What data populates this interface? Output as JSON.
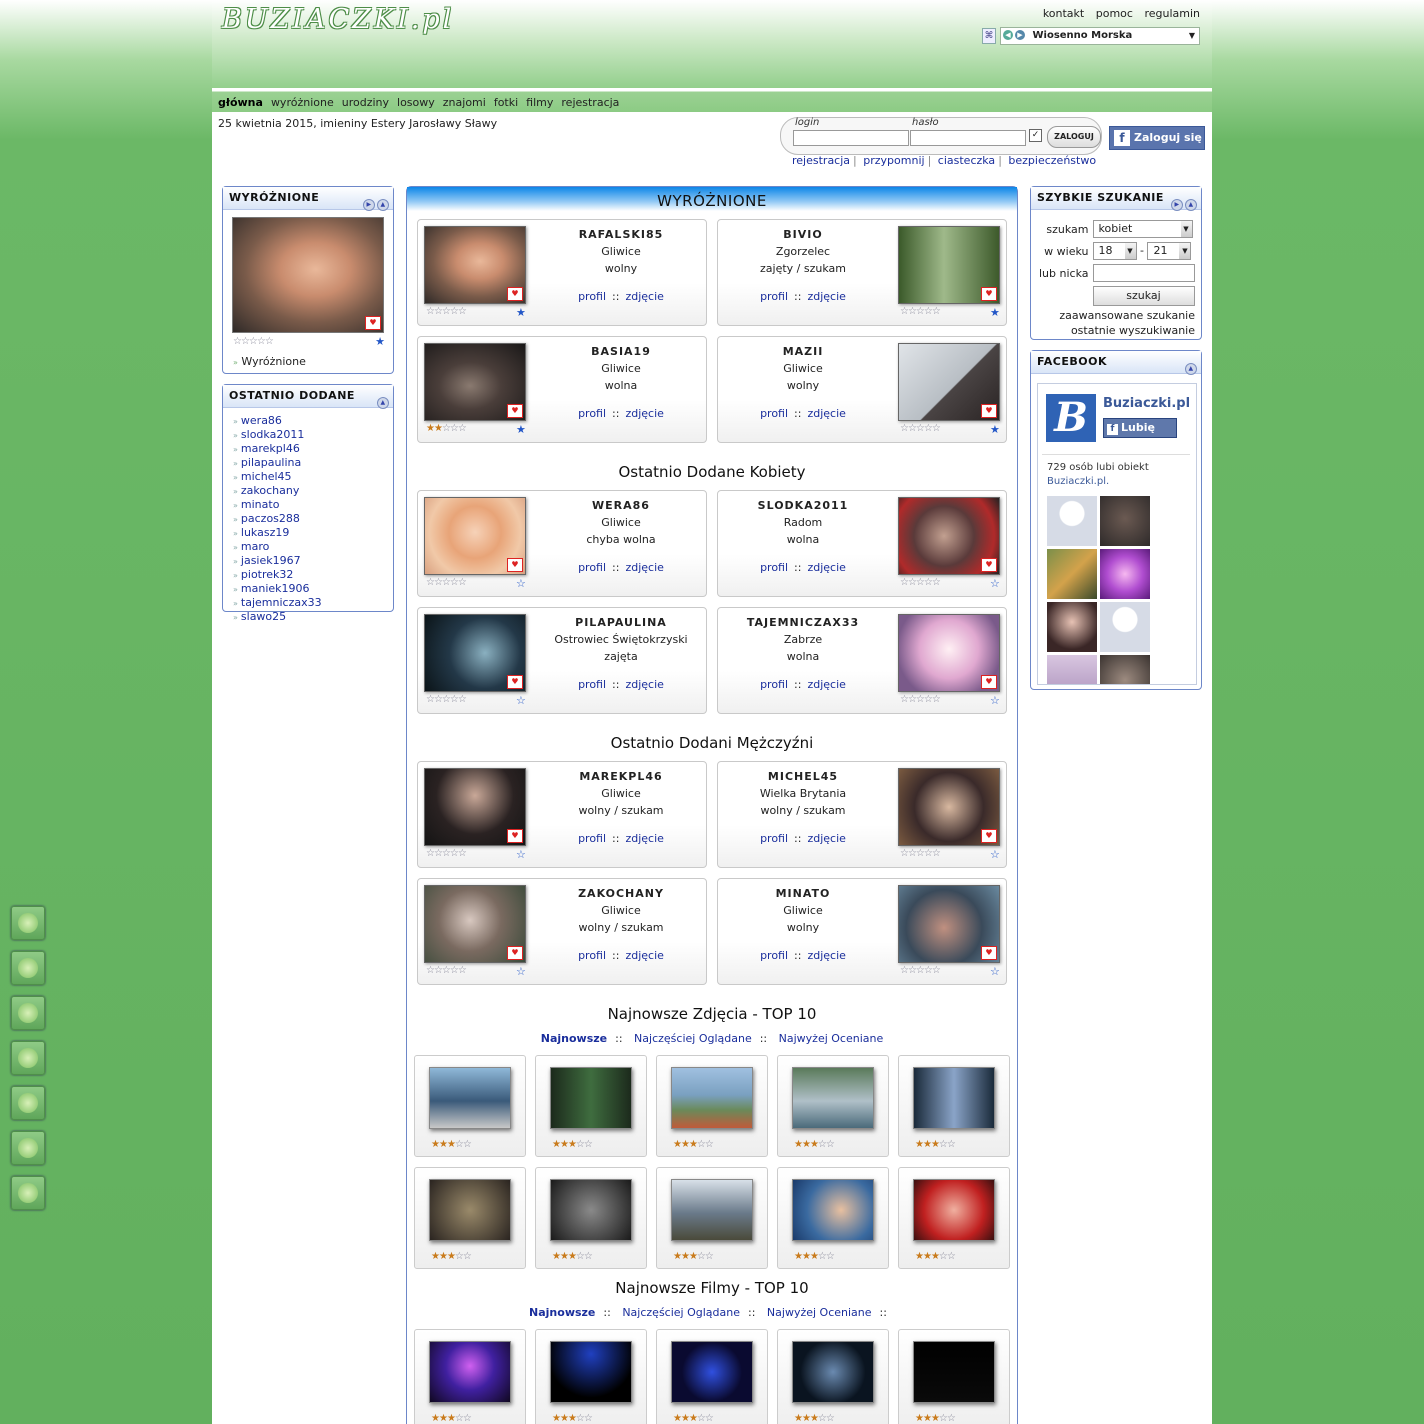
{
  "site": {
    "logo": "BUZIACZKI.pl"
  },
  "toplinks": [
    "kontakt",
    "pomoc",
    "regulamin"
  ],
  "theme": {
    "selected": "Wiosenno Morska"
  },
  "nav": [
    {
      "label": "główna",
      "active": true
    },
    {
      "label": "wyróżnione"
    },
    {
      "label": "urodziny"
    },
    {
      "label": "losowy"
    },
    {
      "label": "znajomi"
    },
    {
      "label": "fotki"
    },
    {
      "label": "filmy"
    },
    {
      "label": "rejestracja"
    }
  ],
  "date_line": "25 kwietnia 2015, imieniny Estery Jarosławy Sławy",
  "login": {
    "login_label": "login",
    "password_label": "hasło",
    "button": "ZALOGUJ",
    "check": "✓",
    "fb_button": "Zaloguj się"
  },
  "login_links": [
    "rejestracja",
    "przypomnij",
    "ciasteczka",
    "bezpieczeństwo"
  ],
  "left": {
    "featured": {
      "title": "WYRÓŻNIONE",
      "link": "Wyróżnione",
      "stars": 0
    },
    "recent": {
      "title": "OSTATNIO DODANE",
      "users": [
        "wera86",
        "slodka2011",
        "marekpl46",
        "pilapaulina",
        "michel45",
        "zakochany",
        "minato",
        "paczos288",
        "lukasz19",
        "maro",
        "jasiek1967",
        "piotrek32",
        "maniek1906",
        "tajemniczax33",
        "slawo25"
      ]
    }
  },
  "main": {
    "title": "WYRÓŻNIONE",
    "profile_link": "profil",
    "photo_link": "zdjęcie",
    "link_sep": "::",
    "featured_cards": [
      {
        "name": "RAFALSKI85",
        "city": "Gliwice",
        "status": "wolny",
        "stars": 0,
        "fav": "★"
      },
      {
        "name": "BIVIO",
        "city": "Zgorzelec",
        "status": "zajęty / szukam",
        "stars": 0,
        "fav": "★"
      },
      {
        "name": "BASIA19",
        "city": "Gliwice",
        "status": "wolna",
        "stars": 2,
        "fav": "★"
      },
      {
        "name": "MAZII",
        "city": "Gliwice",
        "status": "wolny",
        "stars": 0,
        "fav": "★"
      }
    ],
    "women_title": "Ostatnio Dodane Kobiety",
    "women_cards": [
      {
        "name": "WERA86",
        "city": "Gliwice",
        "status": "chyba wolna",
        "stars": 0,
        "fav": "☆"
      },
      {
        "name": "SLODKA2011",
        "city": "Radom",
        "status": "wolna",
        "stars": 0,
        "fav": "☆"
      },
      {
        "name": "PILAPAULINA",
        "city": "Ostrowiec Świętokrzyski",
        "status": "zajęta",
        "stars": 0,
        "fav": "☆"
      },
      {
        "name": "TAJEMNICZAX33",
        "city": "Zabrze",
        "status": "wolna",
        "stars": 0,
        "fav": "☆"
      }
    ],
    "men_title": "Ostatnio Dodani Mężczyźni",
    "men_cards": [
      {
        "name": "MAREKPL46",
        "city": "Gliwice",
        "status": "wolny / szukam",
        "stars": 0,
        "fav": "☆"
      },
      {
        "name": "MICHEL45",
        "city": "Wielka Brytania",
        "status": "wolny / szukam",
        "stars": 0,
        "fav": "☆"
      },
      {
        "name": "ZAKOCHANY",
        "city": "Gliwice",
        "status": "wolny / szukam",
        "stars": 0,
        "fav": "☆"
      },
      {
        "name": "MINATO",
        "city": "Gliwice",
        "status": "wolny",
        "stars": 0,
        "fav": "☆"
      }
    ],
    "photos_title": "Najnowsze Zdjęcia - TOP 10",
    "photos_tabs": [
      "Najnowsze",
      "Najczęściej Oglądane",
      "Najwyżej Oceniane"
    ],
    "photos_stars": [
      3,
      3,
      3,
      3,
      3,
      3,
      3,
      3,
      3,
      3
    ],
    "films_title": "Najnowsze Filmy - TOP 10",
    "films_tabs": [
      "Najnowsze",
      "Najczęściej Oglądane",
      "Najwyżej Oceniane"
    ],
    "films_stars": [
      3,
      3,
      3,
      3,
      3
    ]
  },
  "right": {
    "search": {
      "title": "SZYBKIE SZUKANIE",
      "seek_label": "szukam",
      "seek_value": "kobiet",
      "age_label": "w wieku",
      "age_from": "18",
      "age_dash": "-",
      "age_to": "21",
      "nick_label": "lub nicka",
      "button": "szukaj",
      "advanced": "zaawansowane szukanie",
      "last": "ostatnie wyszukiwanie"
    },
    "facebook": {
      "title": "FACEBOOK",
      "page_name": "Buziaczki.pl",
      "like_button": "Lubię to!",
      "count_text": "729 osób lubi obiekt",
      "count_link": "Buziaczki.pl."
    }
  },
  "colors": {
    "accent": "#1a2e9c",
    "box_border": "#6d87c9",
    "green": "#62b05e",
    "star": "#c97b1c"
  },
  "side_icons": [
    "heart-icon",
    "plus-icon",
    "circle-icon",
    "face-icon",
    "smiley-icon",
    "guitar-icon",
    "microphone-icon"
  ]
}
